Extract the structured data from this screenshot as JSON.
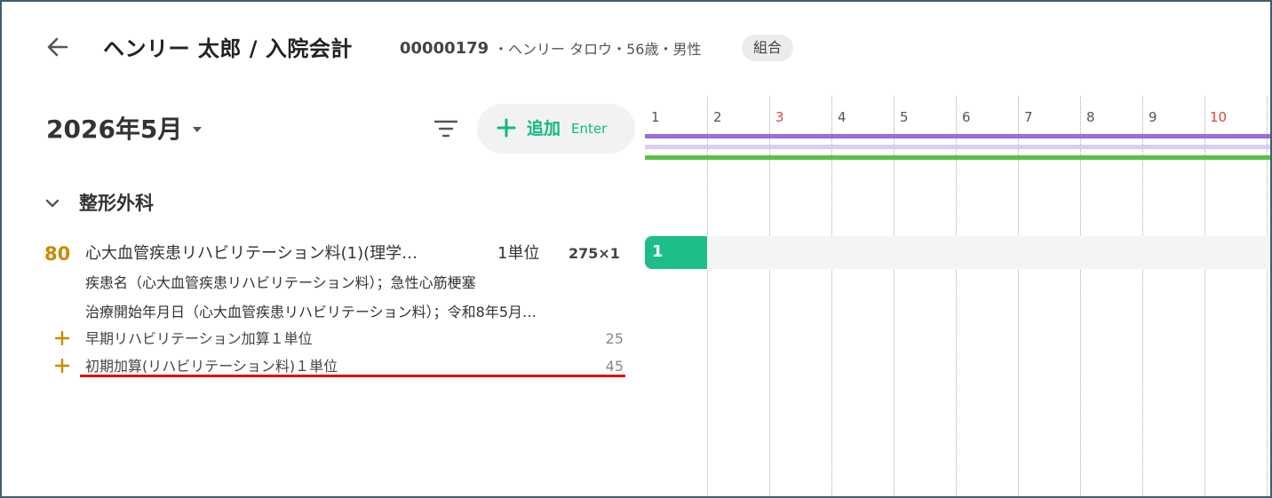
{
  "header": {
    "title": "ヘンリー 太郎 / 入院会計",
    "patient_id": "00000179",
    "patient_info": "・ヘンリー タロウ・56歳・男性",
    "badge": "組合"
  },
  "toolbar": {
    "month": "2026年5月",
    "add_label": "追加",
    "add_shortcut": "Enter"
  },
  "section": {
    "title": "整形外科"
  },
  "item": {
    "score": "80",
    "name": "心大血管疾患リハビリテーション料(1)(理学…",
    "unit": "1単位",
    "price": "275×1",
    "details": [
      "疾患名（心大血管疾患リハビリテーション料）；急性心筋梗塞",
      "治療開始年月日（心大血管疾患リハビリテーション料）；令和8年5月…"
    ],
    "addons": [
      {
        "name": "早期リハビリテーション加算１単位",
        "value": "25"
      },
      {
        "name": "初期加算(リハビリテーション料)１単位",
        "value": "45"
      }
    ]
  },
  "calendar": {
    "days": [
      "1",
      "2",
      "3",
      "4",
      "5",
      "6",
      "7",
      "8",
      "9",
      "10"
    ],
    "chip_count": "1"
  },
  "colors": {
    "accent_green": "#10b981",
    "score_gold": "#c98a00",
    "bar_purple": "#9b6bdb",
    "bar_lavender": "#d9cdf0",
    "bar_green": "#5cbf4a",
    "highlight_red": "#e00000",
    "holiday_red": "#d94a3a"
  }
}
